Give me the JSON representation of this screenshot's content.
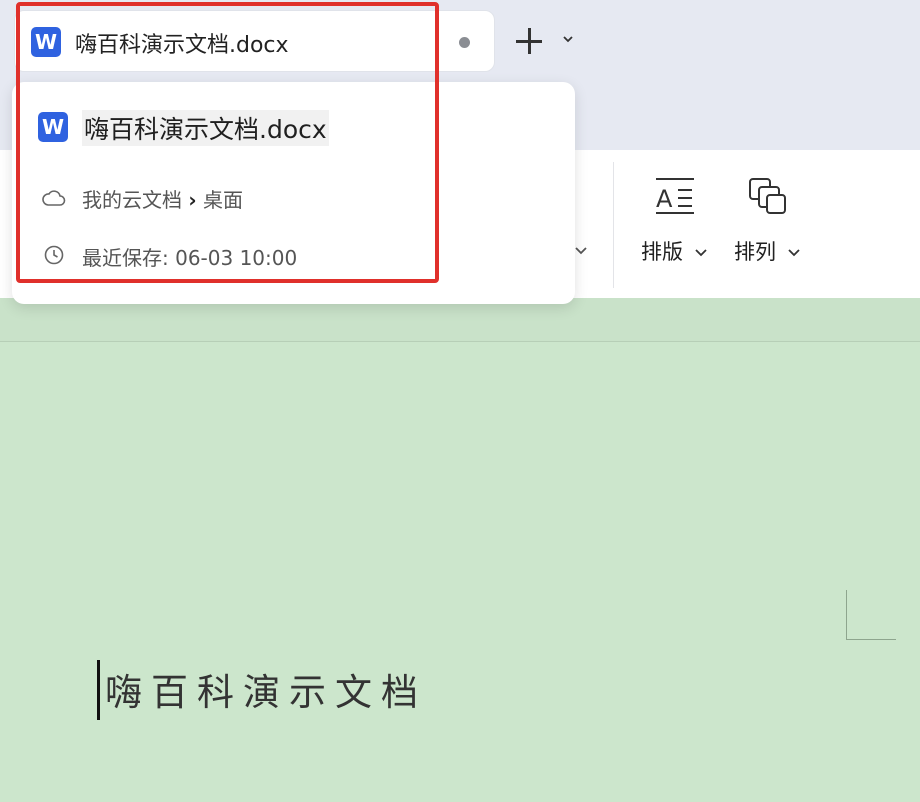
{
  "tab": {
    "icon_letter": "W",
    "title": "嗨百科演示文档.docx"
  },
  "popover": {
    "icon_letter": "W",
    "filename": "嗨百科演示文档.docx",
    "location_parent": "我的云文档",
    "location_separator": "›",
    "location_folder": "桌面",
    "saved_label": "最近保存: 06-03 10:00"
  },
  "ribbon": {
    "layout_label": "排版",
    "arrange_label": "排列"
  },
  "document": {
    "text": "嗨百科演示文档"
  },
  "colors": {
    "accent_word": "#2f62e0",
    "highlight": "#e0302b",
    "doc_background": "#cce6cc"
  },
  "icons": {
    "doc_type": "word-doc-icon",
    "cloud": "cloud-icon",
    "clock": "clock-icon",
    "add_tab": "plus-icon",
    "layout": "text-layout-icon",
    "arrange": "arrange-layers-icon"
  }
}
